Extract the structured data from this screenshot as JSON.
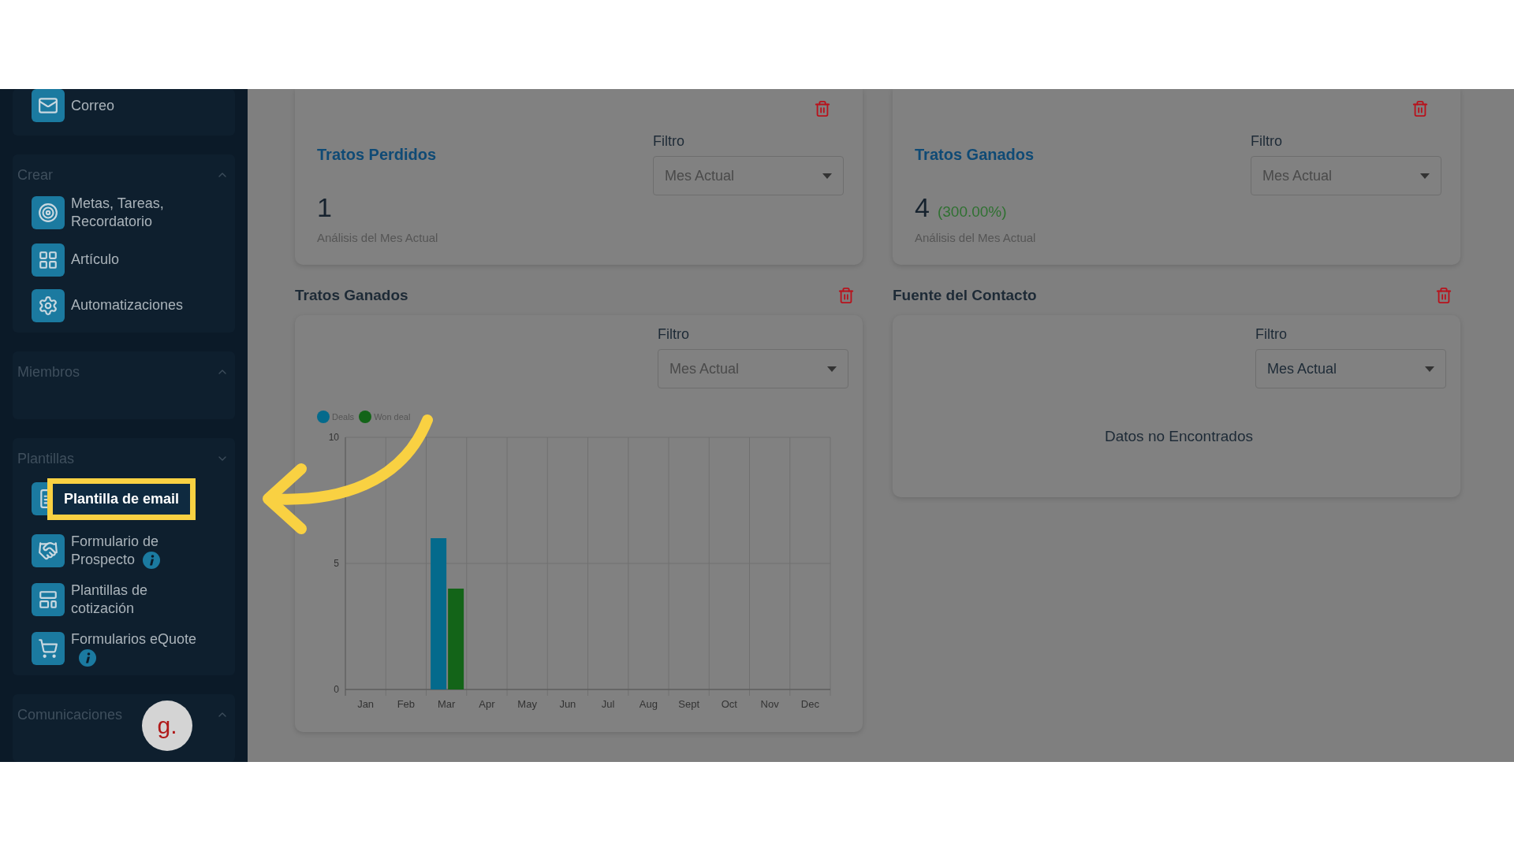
{
  "sidebar": {
    "sections": [
      {
        "items": [
          {
            "label": "Correo",
            "info": false,
            "highlighted": false
          }
        ]
      },
      {
        "title": "Crear",
        "expanded": true,
        "items": [
          {
            "label": "Metas, Tareas, Recordatorio",
            "info": false,
            "highlighted": false
          },
          {
            "label": "Artículo",
            "info": false,
            "highlighted": false
          },
          {
            "label": "Automatizaciones",
            "info": false,
            "highlighted": false
          }
        ]
      },
      {
        "title": "Miembros",
        "expanded": true
      },
      {
        "title": "Plantillas",
        "expanded": false,
        "items": [
          {
            "label": "Plantilla de email",
            "info": false,
            "highlighted": true
          },
          {
            "label": "Formulario de Prospecto",
            "info": true,
            "highlighted": false
          },
          {
            "label": "Plantillas de cotización",
            "info": false,
            "highlighted": false
          },
          {
            "label": "Formularios eQuote",
            "info": true,
            "highlighted": false
          }
        ]
      },
      {
        "title": "Comunicaciones",
        "expanded": true
      }
    ]
  },
  "help_bubble": {
    "label": "g."
  },
  "columns": [
    [
      {
        "kind": "stat",
        "title": "Tratos Perdidos",
        "filter_label": "Filtro",
        "filter_value": "Mes Actual",
        "value": "1",
        "caption": "Análisis del Mes Actual"
      },
      {
        "kind": "chart",
        "heading": "Tratos Ganados",
        "filter_label": "Filtro",
        "filter_value": "Mes Actual",
        "chart_data": {
          "type": "bar",
          "categories": [
            "Jan",
            "Feb",
            "Mar",
            "Apr",
            "May",
            "Jun",
            "Jul",
            "Aug",
            "Sept",
            "Oct",
            "Nov",
            "Dec"
          ],
          "series": [
            {
              "name": "Deals",
              "color": "#046a8c",
              "values": [
                0,
                0,
                6,
                0,
                0,
                0,
                0,
                0,
                0,
                0,
                0,
                0
              ]
            },
            {
              "name": "Won deal",
              "color": "#136418",
              "values": [
                0,
                0,
                4,
                0,
                0,
                0,
                0,
                0,
                0,
                0,
                0,
                0
              ]
            }
          ],
          "ylim": [
            0,
            10
          ],
          "yticks": [
            0,
            5,
            10
          ],
          "legend": "top"
        }
      }
    ],
    [
      {
        "kind": "stat",
        "title": "Tratos Ganados",
        "filter_label": "Filtro",
        "filter_value": "Mes Actual",
        "value": "4",
        "change": "(300.00%)",
        "caption": "Análisis del Mes Actual"
      },
      {
        "kind": "empty",
        "heading": "Fuente del Contacto",
        "filter_label": "Filtro",
        "filter_value": "Mes Actual",
        "message": "Datos no Encontrados"
      }
    ]
  ]
}
